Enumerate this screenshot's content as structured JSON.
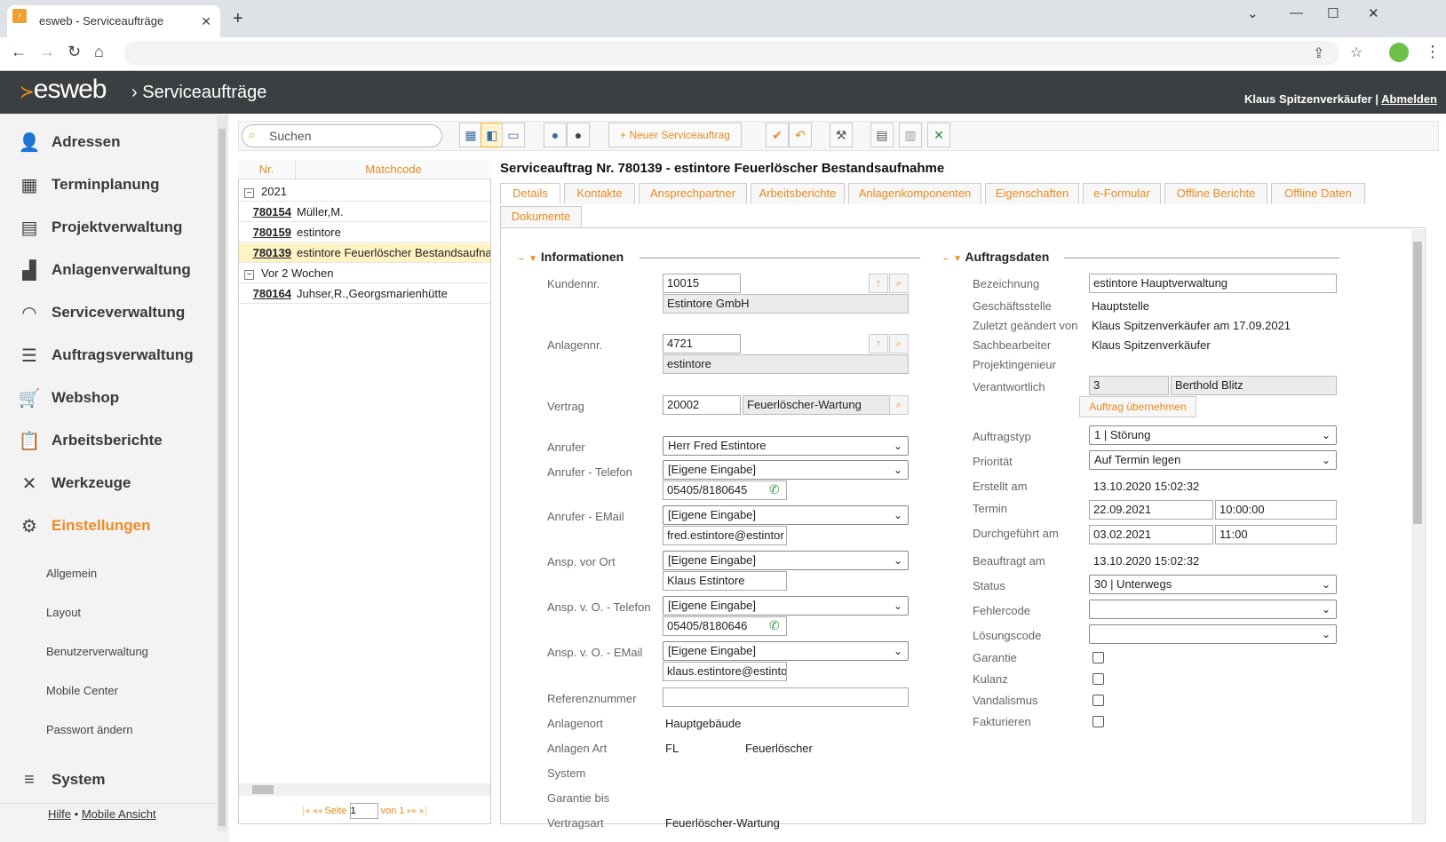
{
  "browser": {
    "tab_title": "esweb - Serviceaufträge",
    "tab_close": "✕",
    "new_tab": "+"
  },
  "header": {
    "logo": "esweb",
    "separator": "›",
    "title": "Serviceaufträge",
    "user": "Klaus Spitzenverkäufer",
    "divider": "|",
    "logout": "Abmelden"
  },
  "sidebar": {
    "items": [
      {
        "label": "Adressen",
        "icon": "address-icon"
      },
      {
        "label": "Terminplanung",
        "icon": "calendar-icon"
      },
      {
        "label": "Projektverwaltung",
        "icon": "project-icon"
      },
      {
        "label": "Anlagenverwaltung",
        "icon": "factory-icon"
      },
      {
        "label": "Serviceverwaltung",
        "icon": "headset-icon"
      },
      {
        "label": "Auftragsverwaltung",
        "icon": "list-icon"
      },
      {
        "label": "Webshop",
        "icon": "cart-icon"
      },
      {
        "label": "Arbeitsberichte",
        "icon": "clipboard-icon"
      },
      {
        "label": "Werkzeuge",
        "icon": "tools-icon"
      },
      {
        "label": "Einstellungen",
        "icon": "gears-icon"
      }
    ],
    "sub": [
      "Allgemein",
      "Layout",
      "Benutzerverwaltung",
      "Mobile Center",
      "Passwort ändern"
    ],
    "system": "System",
    "footer": {
      "help": "Hilfe",
      "dot": "•",
      "mobile": "Mobile Ansicht"
    }
  },
  "toolbar": {
    "search_placeholder": "Suchen",
    "new_order": "+ Neuer Serviceauftrag"
  },
  "list": {
    "col_nr": "Nr.",
    "col_matchcode": "Matchcode",
    "group1": "2021",
    "group2": "Vor 2 Wochen",
    "rows": [
      {
        "nr": "780154",
        "mc": "Müller,M."
      },
      {
        "nr": "780159",
        "mc": "estintore"
      },
      {
        "nr": "780139",
        "mc": "estintore Feuerlöscher Bestandsaufnah"
      },
      {
        "nr": "780164",
        "mc": "Juhser,R.,Georgsmarienhütte"
      }
    ],
    "pager": {
      "label": "Seite",
      "page": "1",
      "of": "von 1"
    }
  },
  "detail": {
    "title": "Serviceauftrag Nr. 780139 - estintore Feuerlöscher Bestandsaufnahme",
    "tabs": [
      "Details",
      "Kontakte",
      "Ansprechpartner",
      "Arbeitsberichte",
      "Anlagenkomponenten",
      "Eigenschaften",
      "e-Formular",
      "Offline Berichte",
      "Offline Daten",
      "Dokumente"
    ],
    "info": {
      "section": "Informationen",
      "kundennr_label": "Kundennr.",
      "kundennr": "10015",
      "kunde": "Estintore GmbH",
      "anlagennr_label": "Anlagennr.",
      "anlagennr": "4721",
      "anlage": "estintore",
      "vertrag_label": "Vertrag",
      "vertrag": "20002",
      "vertrag_name": "Feuerlöscher-Wartung",
      "anrufer_label": "Anrufer",
      "anrufer": "Herr Fred Estintore",
      "anrufer_tel_label": "Anrufer - Telefon",
      "anrufer_tel_sel": "[Eigene Eingabe]",
      "anrufer_tel": "05405/8180645",
      "anrufer_mail_label": "Anrufer - EMail",
      "anrufer_mail_sel": "[Eigene Eingabe]",
      "anrufer_mail": "fred.estintore@estintor",
      "ansp_label": "Ansp. vor Ort",
      "ansp_sel": "[Eigene Eingabe]",
      "ansp": "Klaus Estintore",
      "ansp_tel_label": "Ansp. v. O. - Telefon",
      "ansp_tel_sel": "[Eigene Eingabe]",
      "ansp_tel": "05405/8180646",
      "ansp_mail_label": "Ansp. v. O. - EMail",
      "ansp_mail_sel": "[Eigene Eingabe]",
      "ansp_mail": "klaus.estintore@estinto",
      "ref_label": "Referenznummer",
      "ref": "",
      "ort_label": "Anlagenort",
      "ort": "Hauptgebäude",
      "art_label": "Anlagen Art",
      "art_code": "FL",
      "art": "Feuerlöscher",
      "system_label": "System",
      "garantie_bis_label": "Garantie bis",
      "vertragsart_label": "Vertragsart",
      "vertragsart": "Feuerlöscher-Wartung"
    },
    "auftrag": {
      "section": "Auftragsdaten",
      "bez_label": "Bezeichnung",
      "bez": "estintore Hauptverwaltung",
      "gs_label": "Geschäftsstelle",
      "gs": "Hauptstelle",
      "geaendert_label": "Zuletzt geändert von",
      "geaendert": "Klaus Spitzenverkäufer am 17.09.2021",
      "sb_label": "Sachbearbeiter",
      "sb": "Klaus Spitzenverkäufer",
      "pi_label": "Projektingenieur",
      "verantw_label": "Verantwortlich",
      "verantw_nr": "3",
      "verantw": "Berthold Blitz",
      "take_btn": "Auftrag übernehmen",
      "typ_label": "Auftragstyp",
      "typ": "1 | Störung",
      "prio_label": "Priorität",
      "prio": "Auf Termin legen",
      "erstellt_label": "Erstellt am",
      "erstellt": "13.10.2020 15:02:32",
      "termin_label": "Termin",
      "termin_date": "22.09.2021",
      "termin_time": "10:00:00",
      "durch_label": "Durchgeführt am",
      "durch_date": "03.02.2021",
      "durch_time": "11:00",
      "beauftragt_label": "Beauftragt am",
      "beauftragt": "13.10.2020 15:02:32",
      "status_label": "Status",
      "status": "30 | Unterwegs",
      "fehler_label": "Fehlercode",
      "fehler": "",
      "loesung_label": "Lösungscode",
      "loesung": "",
      "garantie_label": "Garantie",
      "kulanz_label": "Kulanz",
      "vandal_label": "Vandalismus",
      "fakt_label": "Fakturieren"
    }
  },
  "colors": {
    "accent": "#f08a24",
    "header_bg": "#3b3f41",
    "selected_row": "#fff3c4"
  }
}
